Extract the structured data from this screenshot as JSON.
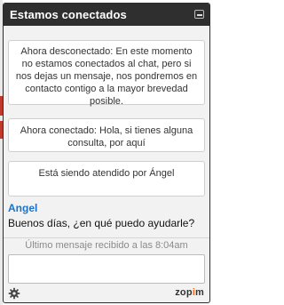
{
  "header": {
    "title": "Estamos conectados"
  },
  "messages": {
    "offline": "Ahora desconectado: En este momento no estamos conectados al chat, pero si nos dejas un mensaje, nos pondremos en contacto contigo a la mayor brevedad posible.",
    "online": "Ahora conectado: Hola, si tienes alguna consulta, por aquí",
    "attended": "Está siendo atendido por Ángel"
  },
  "agent": {
    "name": "Angel",
    "message": "Buenos días, ¿en qué puedo ayudarle?"
  },
  "status": {
    "last_message": "Último mensaje recibido a las 8:04am"
  },
  "input": {
    "value": "",
    "placeholder": ""
  },
  "footer": {
    "brand_prefix": "zop",
    "brand_i": "i",
    "brand_suffix": "m",
    "settings_icon": "gear-icon"
  },
  "colors": {
    "header_bg": "#2f2f2f",
    "agent_name": "#1a73c8",
    "brand_accent": "#ff6a1a"
  }
}
